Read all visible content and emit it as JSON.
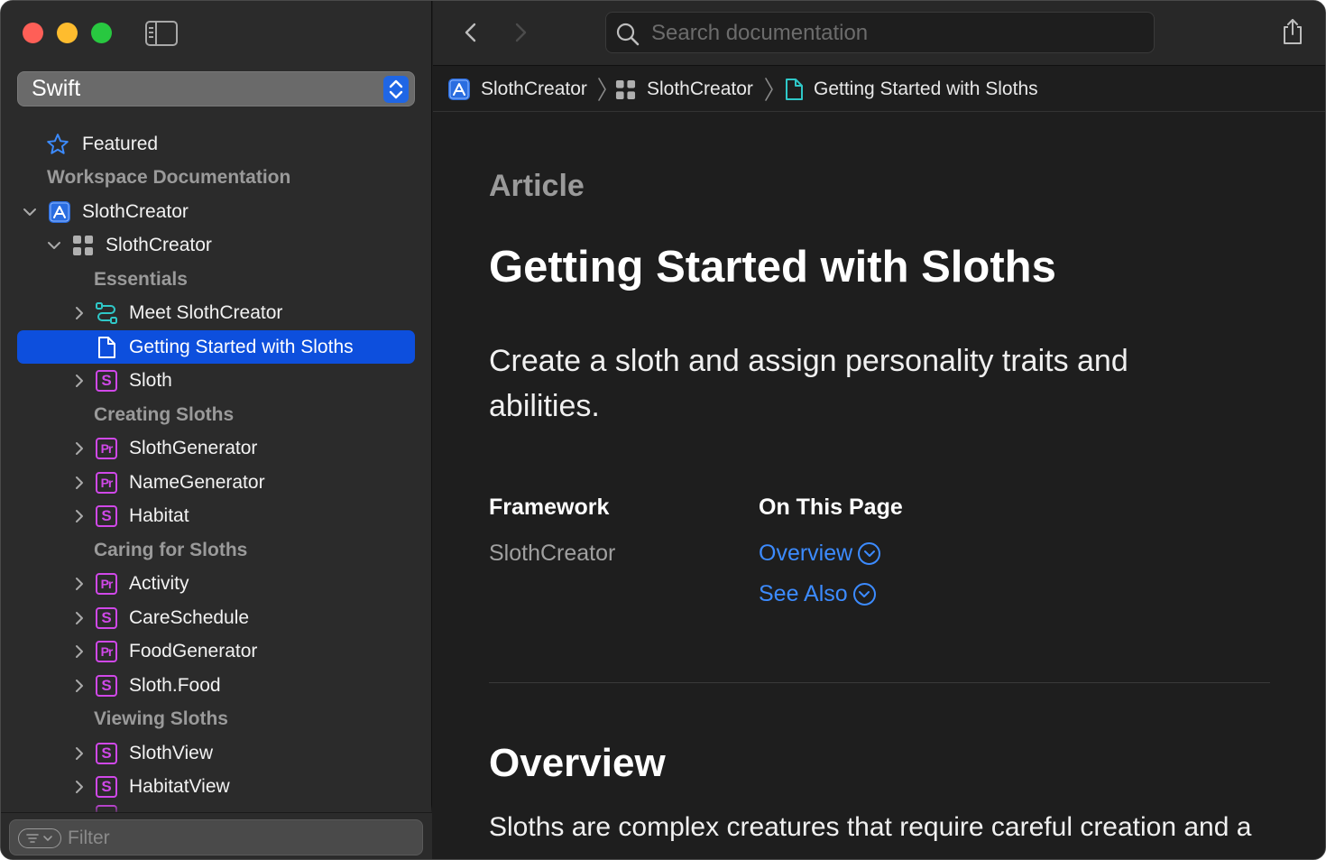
{
  "window": {
    "traffic_lights": [
      "close",
      "minimize",
      "zoom"
    ]
  },
  "sidebar": {
    "language": "Swift",
    "filter_placeholder": "Filter",
    "items": [
      {
        "type": "link",
        "label": "Featured",
        "icon": "star-icon"
      },
      {
        "type": "section",
        "label": "Workspace Documentation"
      },
      {
        "type": "item",
        "label": "SlothCreator",
        "icon": "app-icon",
        "expanded": true
      },
      {
        "type": "item",
        "label": "SlothCreator",
        "icon": "module-icon",
        "expanded": true
      },
      {
        "type": "section",
        "label": "Essentials"
      },
      {
        "type": "item",
        "label": "Meet SlothCreator",
        "icon": "tutorial-icon"
      },
      {
        "type": "item",
        "label": "Getting Started with Sloths",
        "icon": "article-icon",
        "selected": true
      },
      {
        "type": "item",
        "label": "Sloth",
        "icon": "struct-icon",
        "badge": "S"
      },
      {
        "type": "section",
        "label": "Creating Sloths"
      },
      {
        "type": "item",
        "label": "SlothGenerator",
        "icon": "protocol-icon",
        "badge": "Pr"
      },
      {
        "type": "item",
        "label": "NameGenerator",
        "icon": "protocol-icon",
        "badge": "Pr"
      },
      {
        "type": "item",
        "label": "Habitat",
        "icon": "struct-icon",
        "badge": "S"
      },
      {
        "type": "section",
        "label": "Caring for Sloths"
      },
      {
        "type": "item",
        "label": "Activity",
        "icon": "protocol-icon",
        "badge": "Pr"
      },
      {
        "type": "item",
        "label": "CareSchedule",
        "icon": "struct-icon",
        "badge": "S"
      },
      {
        "type": "item",
        "label": "FoodGenerator",
        "icon": "protocol-icon",
        "badge": "Pr"
      },
      {
        "type": "item",
        "label": "Sloth.Food",
        "icon": "struct-icon",
        "badge": "S"
      },
      {
        "type": "section",
        "label": "Viewing Sloths"
      },
      {
        "type": "item",
        "label": "SlothView",
        "icon": "struct-icon",
        "badge": "S"
      },
      {
        "type": "item",
        "label": "HabitatView",
        "icon": "struct-icon",
        "badge": "S"
      }
    ]
  },
  "toolbar": {
    "search_placeholder": "Search documentation"
  },
  "breadcrumb": [
    {
      "label": "SlothCreator",
      "icon": "app-icon"
    },
    {
      "label": "SlothCreator",
      "icon": "module-icon"
    },
    {
      "label": "Getting Started with Sloths",
      "icon": "article-icon"
    }
  ],
  "article": {
    "eyebrow": "Article",
    "title": "Getting Started with Sloths",
    "abstract": "Create a sloth and assign personality traits and abilities.",
    "framework_label": "Framework",
    "framework_value": "SlothCreator",
    "on_this_page_label": "On This Page",
    "on_this_page_links": [
      "Overview",
      "See Also"
    ],
    "overview_heading": "Overview",
    "overview_body": "Sloths are complex creatures that require careful creation and a"
  },
  "colors": {
    "accent": "#0d4fdd",
    "link": "#3c8bff",
    "badge": "#d048e8",
    "tutorial": "#2fc8c8"
  }
}
